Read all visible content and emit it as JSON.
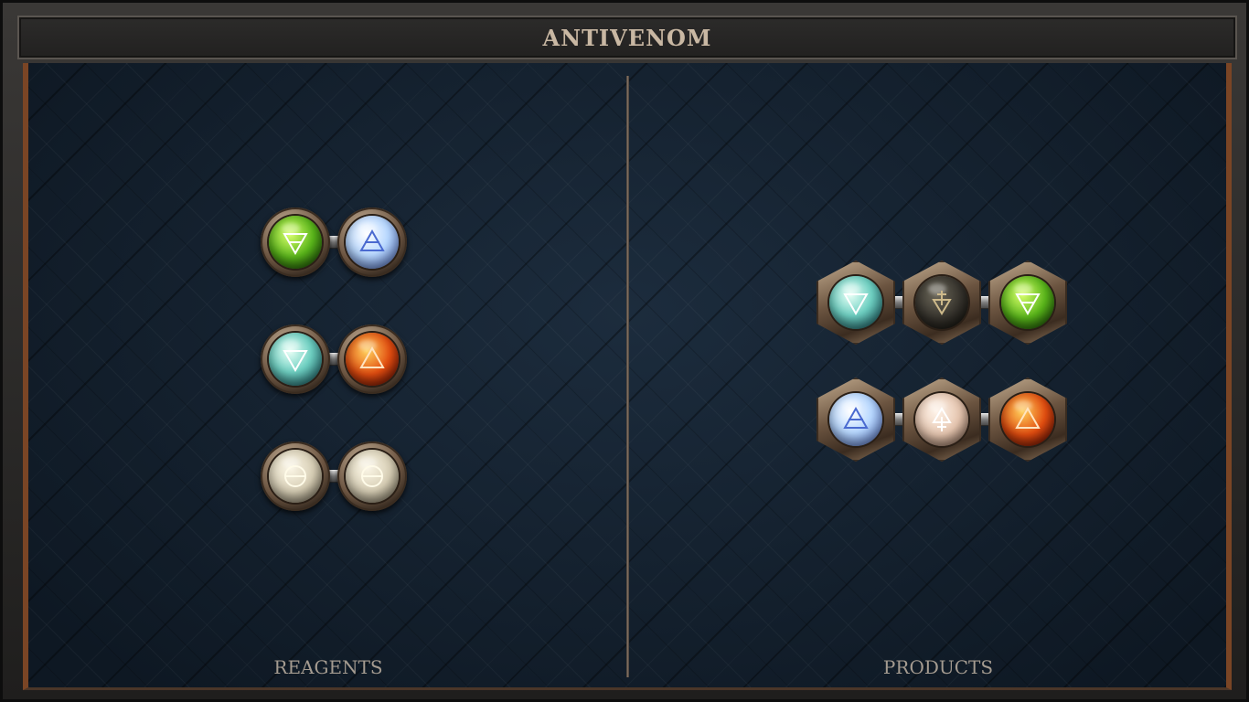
{
  "title": "ANTIVENOM",
  "sections": {
    "reagents_label": "REAGENTS",
    "products_label": "PRODUCTS"
  },
  "reagents": [
    {
      "atoms": [
        {
          "element": "earth",
          "color": "#59b51a",
          "icon": "earth-icon"
        },
        {
          "element": "air",
          "color": "#b8d8ff",
          "icon": "air-icon"
        }
      ]
    },
    {
      "atoms": [
        {
          "element": "water",
          "color": "#6fd0c2",
          "icon": "water-icon"
        },
        {
          "element": "fire",
          "color": "#e24d10",
          "icon": "fire-icon"
        }
      ]
    },
    {
      "atoms": [
        {
          "element": "salt",
          "color": "#d8cfb6",
          "icon": "salt-icon"
        },
        {
          "element": "salt",
          "color": "#d8cfb6",
          "icon": "salt-icon"
        }
      ]
    }
  ],
  "products": [
    {
      "atoms": [
        {
          "element": "water",
          "color": "#6fd0c2",
          "icon": "water-icon"
        },
        {
          "element": "mors",
          "color": "#33302a",
          "icon": "mors-icon"
        },
        {
          "element": "earth",
          "color": "#59b51a",
          "icon": "earth-icon"
        }
      ]
    },
    {
      "atoms": [
        {
          "element": "air",
          "color": "#b8d8ff",
          "icon": "air-icon"
        },
        {
          "element": "vitae",
          "color": "#e6c6b0",
          "icon": "vitae-icon"
        },
        {
          "element": "fire",
          "color": "#e24d10",
          "icon": "fire-icon"
        }
      ]
    }
  ]
}
